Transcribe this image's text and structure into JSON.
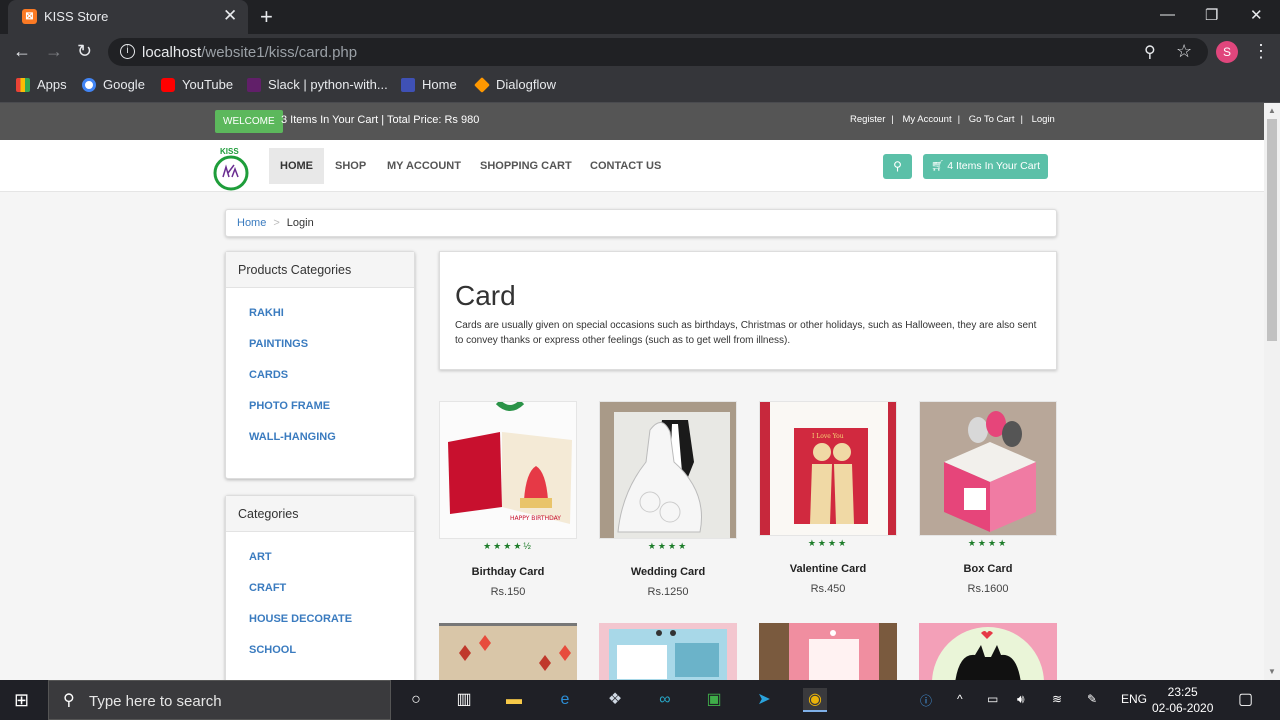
{
  "browser": {
    "tab_title": "KISS Store",
    "url_host": "localhost",
    "url_path": "/website1/kiss/card.php",
    "profile_initial": "S",
    "bookmarks": [
      {
        "label": "Apps",
        "color": "#ea4335"
      },
      {
        "label": "Google",
        "color": "#4285f4"
      },
      {
        "label": "YouTube",
        "color": "#ff0000"
      },
      {
        "label": "Slack | python-with...",
        "color": "#611f69"
      },
      {
        "label": "Home",
        "color": "#3f51b5"
      },
      {
        "label": "Dialogflow",
        "color": "#ff9800"
      }
    ]
  },
  "topbar": {
    "welcome": "WELCOME",
    "cart_summary": "3 Items In Your Cart | Total Price: Rs 980",
    "links": [
      "Register",
      "My Account",
      "Go To Cart",
      "Login"
    ]
  },
  "header": {
    "logo_text": "KISS",
    "nav": [
      "HOME",
      "SHOP",
      "MY ACCOUNT",
      "SHOPPING CART",
      "CONTACT US"
    ],
    "cart_button": "4 Items In Your Cart"
  },
  "breadcrumb": {
    "home": "Home",
    "current": "Login"
  },
  "sidebar": {
    "products_title": "Products Categories",
    "products": [
      "RAKHI",
      "PAINTINGS",
      "CARDS",
      "PHOTO FRAME",
      "WALL-HANGING"
    ],
    "categories_title": "Categories",
    "categories": [
      "ART",
      "CRAFT",
      "HOUSE DECORATE",
      "SCHOOL"
    ]
  },
  "hero": {
    "title": "Card",
    "description": "Cards are usually given on special occasions such as birthdays, Christmas or other holidays, such as Halloween, they are also sent to convey thanks or express other feelings (such as to get well from illness)."
  },
  "products": [
    {
      "name": "Birthday Card",
      "price": "Rs.150",
      "rating": 4.5
    },
    {
      "name": "Wedding Card",
      "price": "Rs.1250",
      "rating": 4
    },
    {
      "name": "Valentine Card",
      "price": "Rs.450",
      "rating": 4
    },
    {
      "name": "Box Card",
      "price": "Rs.1600",
      "rating": 4
    }
  ],
  "taskbar": {
    "search_placeholder": "Type here to search",
    "language": "ENG",
    "time": "23:25",
    "date": "02-06-2020"
  }
}
